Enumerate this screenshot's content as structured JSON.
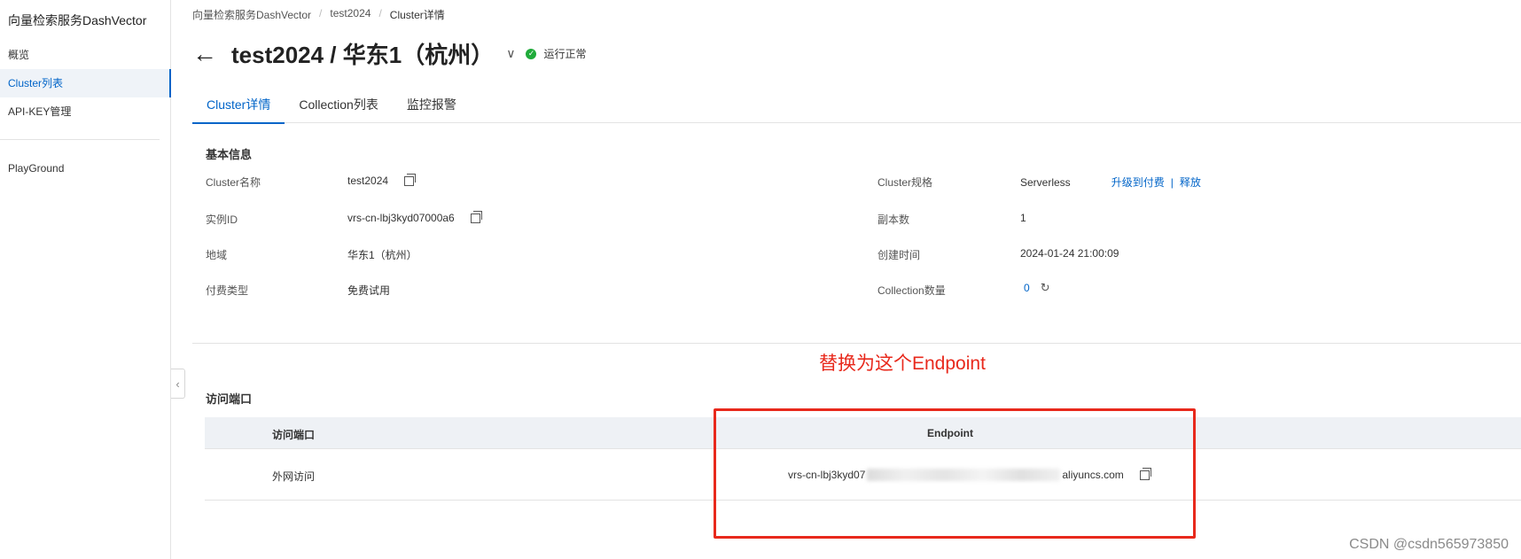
{
  "sidebar": {
    "title": "向量检索服务DashVector",
    "items": [
      {
        "label": "概览"
      },
      {
        "label": "Cluster列表"
      },
      {
        "label": "API-KEY管理"
      },
      {
        "label": "PlayGround"
      }
    ],
    "collapse_glyph": "‹"
  },
  "breadcrumb": [
    "向量检索服务DashVector",
    "test2024",
    "Cluster详情"
  ],
  "breadcrumb_sep": "/",
  "header": {
    "back_glyph": "←",
    "title": "test2024 / 华东1（杭州）",
    "caret_glyph": "∨",
    "status_text": "运行正常",
    "status_glyph": "✓"
  },
  "tabs": [
    {
      "label": "Cluster详情"
    },
    {
      "label": "Collection列表"
    },
    {
      "label": "监控报警"
    }
  ],
  "basic_info": {
    "section_title": "基本信息",
    "left": [
      {
        "label": "Cluster名称",
        "value": "test2024"
      },
      {
        "label": "实例ID",
        "value": "vrs-cn-lbj3kyd07000a6"
      },
      {
        "label": "地域",
        "value": "华东1（杭州）"
      },
      {
        "label": "付费类型",
        "value": "免费试用"
      }
    ],
    "right": [
      {
        "label": "Cluster规格",
        "value": "Serverless"
      },
      {
        "label": "副本数",
        "value": "1"
      },
      {
        "label": "创建时间",
        "value": "2024-01-24 21:00:09"
      },
      {
        "label": "Collection数量",
        "value": "0"
      }
    ],
    "upgrade_link": "升级到付费",
    "link_sep": "|",
    "release_link": "释放",
    "refresh_glyph": "↻"
  },
  "access": {
    "section_title": "访问端口",
    "columns": [
      "访问端口",
      "Endpoint"
    ],
    "rows": [
      {
        "port": "外网访问",
        "endpoint_prefix": "vrs-cn-lbj3kyd07",
        "endpoint_suffix": "aliyuncs.com"
      }
    ]
  },
  "annotation": {
    "text": "替换为这个Endpoint",
    "color": "#e8291c"
  },
  "watermark": "CSDN @csdn565973850",
  "colors": {
    "accent": "#0064c8",
    "status_ok": "#1fab3a",
    "highlight": "#e8291c"
  }
}
